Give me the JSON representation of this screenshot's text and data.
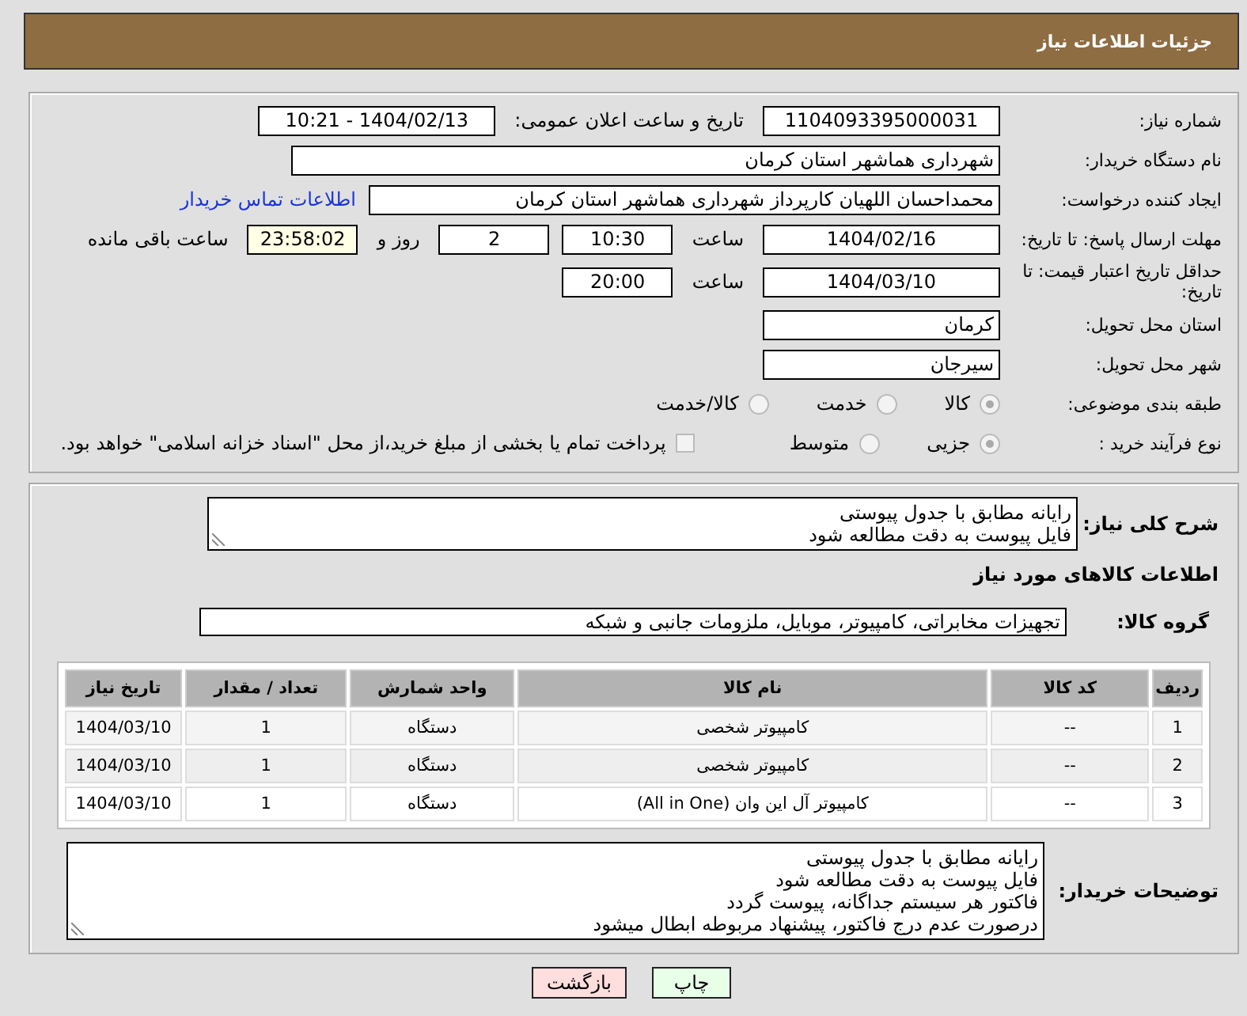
{
  "header": {
    "title": "جزئیات اطلاعات نیاز"
  },
  "form_rows": [
    {
      "label": "شماره نیاز:",
      "items": [
        {
          "kind": "field",
          "value": "1104093395000031"
        },
        {
          "kind": "text",
          "value": "تاریخ و ساعت اعلان عمومی:"
        },
        {
          "kind": "field",
          "value": "1404/02/13 - 10:21"
        }
      ]
    },
    {
      "label": "نام دستگاه خریدار:",
      "items": [
        {
          "kind": "field",
          "value": "شهرداری هماشهر استان کرمان"
        }
      ]
    },
    {
      "label": "ایجاد کننده درخواست:",
      "items": [
        {
          "kind": "field",
          "value": "محمداحسان اللهیان کارپرداز  شهرداری هماشهر استان کرمان"
        },
        {
          "kind": "link",
          "value": "اطلاعات تماس خریدار"
        }
      ]
    },
    {
      "label": "مهلت ارسال پاسخ: تا تاریخ:",
      "items": [
        {
          "kind": "field",
          "value": "1404/02/16"
        },
        {
          "kind": "text",
          "value": "ساعت"
        },
        {
          "kind": "field",
          "value": "10:30"
        },
        {
          "kind": "field",
          "value": "2"
        },
        {
          "kind": "text",
          "value": "روز و"
        },
        {
          "kind": "timer",
          "value": "23:58:02"
        },
        {
          "kind": "text",
          "value": "ساعت باقی مانده"
        }
      ]
    },
    {
      "label": "حداقل تاریخ اعتبار قیمت: تا تاریخ:",
      "items": [
        {
          "kind": "field",
          "value": "1404/03/10"
        },
        {
          "kind": "text",
          "value": "ساعت"
        },
        {
          "kind": "field",
          "value": "20:00"
        }
      ]
    },
    {
      "label": "استان محل تحویل:",
      "items": [
        {
          "kind": "field",
          "value": "کرمان"
        }
      ]
    },
    {
      "label": "شهر محل تحویل:",
      "items": [
        {
          "kind": "field",
          "value": "سیرجان"
        }
      ]
    },
    {
      "label": "طبقه بندی موضوعی:",
      "items": [
        {
          "kind": "radio",
          "value": "کالا",
          "selected": true
        },
        {
          "kind": "radio",
          "value": "خدمت",
          "selected": false
        },
        {
          "kind": "radio",
          "value": "کالا/خدمت",
          "selected": false
        }
      ]
    },
    {
      "label": "نوع فرآیند خرید :",
      "items": [
        {
          "kind": "radio",
          "value": "جزیی",
          "selected": true
        },
        {
          "kind": "radio",
          "value": "متوسط",
          "selected": false
        },
        {
          "kind": "checkbox",
          "value": "پرداخت تمام یا بخشی از مبلغ خرید،از محل \"اسناد خزانه اسلامی\" خواهد بود.",
          "checked": false
        }
      ]
    }
  ],
  "description": {
    "label": "شرح کلی نیاز:",
    "value": "رایانه مطابق با جدول پیوستی\nفایل پیوست به دقت مطالعه شود"
  },
  "goods_section": {
    "title": "اطلاعات کالاهای مورد نیاز",
    "group_label": "گروه کالا:",
    "group_value": "تجهیزات مخابراتی، کامپیوتر، موبایل، ملزومات جانبی و شبکه"
  },
  "table": {
    "columns": [
      "ردیف",
      "کد کالا",
      "نام کالا",
      "واحد شمارش",
      "تعداد / مقدار",
      "تاریخ نیاز"
    ],
    "rows": [
      [
        "1",
        "--",
        "کامپیوتر شخصی",
        "دستگاه",
        "1",
        "1404/03/10"
      ],
      [
        "2",
        "--",
        "کامپیوتر شخصی",
        "دستگاه",
        "1",
        "1404/03/10"
      ],
      [
        "3",
        "--",
        "کامپیوتر آل این وان (All in One)",
        "دستگاه",
        "1",
        "1404/03/10"
      ]
    ]
  },
  "buyer_notes": {
    "label": "توضیحات خریدار:",
    "value": "رایانه مطابق با جدول پیوستی\nفایل پیوست به دقت مطالعه شود\nفاکتور هر سیستم جداگانه، پیوست گردد\nدرصورت عدم درج فاکتور، پیشنهاد مربوطه ابطال میشود"
  },
  "buttons": [
    {
      "label": "چاپ",
      "kind": "print"
    },
    {
      "label": "بازگشت",
      "kind": "back"
    }
  ]
}
